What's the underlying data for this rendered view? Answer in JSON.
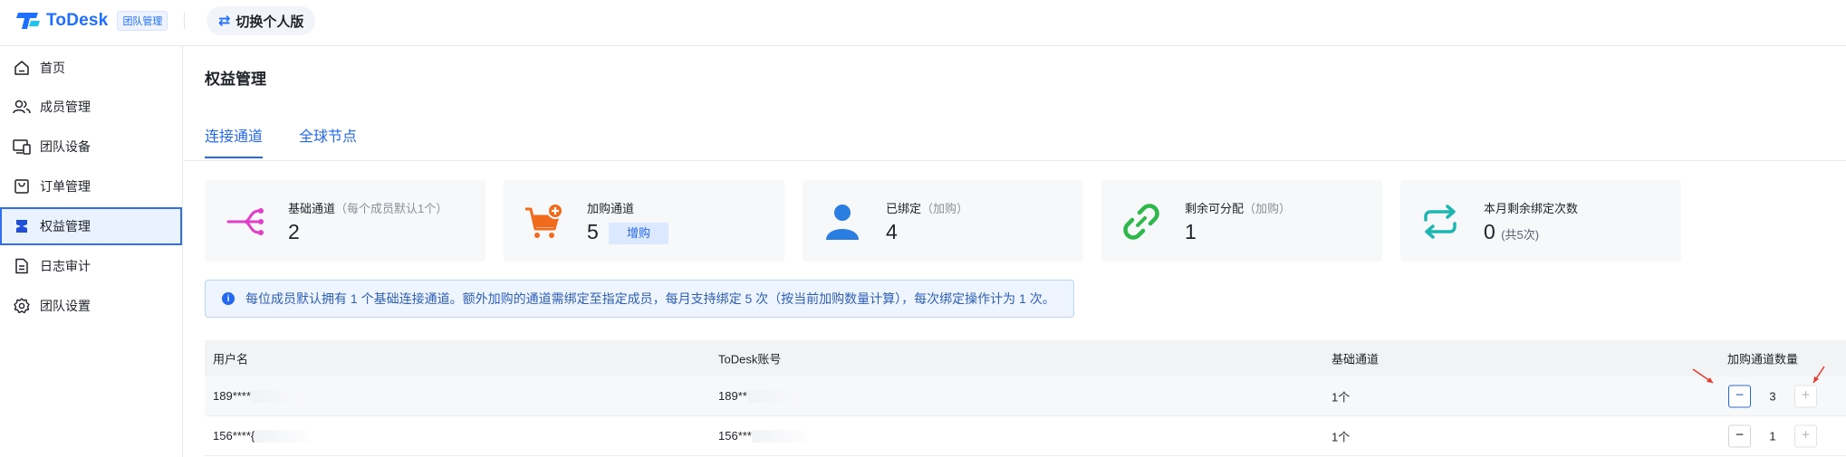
{
  "header": {
    "logo_text": "ToDesk",
    "badge": "团队管理",
    "switch_label": "切换个人版",
    "switch_icon": "swap-arrows-icon"
  },
  "sidebar": {
    "items": [
      {
        "label": "首页",
        "icon": "home-icon"
      },
      {
        "label": "成员管理",
        "icon": "users-icon"
      },
      {
        "label": "团队设备",
        "icon": "devices-icon"
      },
      {
        "label": "订单管理",
        "icon": "bag-icon"
      },
      {
        "label": "权益管理",
        "icon": "benefit-icon",
        "active": true
      },
      {
        "label": "日志审计",
        "icon": "document-icon"
      },
      {
        "label": "团队设置",
        "icon": "gear-icon"
      }
    ]
  },
  "main": {
    "title": "权益管理",
    "tabs": [
      {
        "label": "连接通道",
        "active": true
      },
      {
        "label": "全球节点",
        "active": false
      }
    ],
    "cards": [
      {
        "label": "基础通道",
        "note": "（每个成员默认1个）",
        "value": "2",
        "icon": "channel-branch-icon"
      },
      {
        "label": "加购通道",
        "note": "",
        "value": "5",
        "tag": "增购",
        "icon": "cart-add-icon"
      },
      {
        "label": "已绑定",
        "note": "（加购）",
        "value": "4",
        "icon": "person-icon"
      },
      {
        "label": "剩余可分配",
        "note": "（加购）",
        "value": "1",
        "icon": "link-icon"
      },
      {
        "label": "本月剩余绑定次数",
        "note": "",
        "value": "0",
        "sub": "(共5次)",
        "icon": "repeat-icon"
      }
    ],
    "notice": "每位成员默认拥有 1 个基础连接通道。额外加购的通道需绑定至指定成员，每月支持绑定 5 次（按当前加购数量计算），每次绑定操作计为 1 次。",
    "table": {
      "columns": [
        "用户名",
        "ToDesk账号",
        "基础通道",
        "加购通道数量"
      ],
      "rows": [
        {
          "username": "189****",
          "account": "189**",
          "base": "1个",
          "extra": "3"
        },
        {
          "username": "156****{",
          "account": "156***",
          "base": "1个",
          "extra": "1"
        }
      ]
    }
  },
  "colors": {
    "accent": "#2468f2",
    "card_bg": "#f7f8fa",
    "notice_bg": "#eef5ff"
  }
}
